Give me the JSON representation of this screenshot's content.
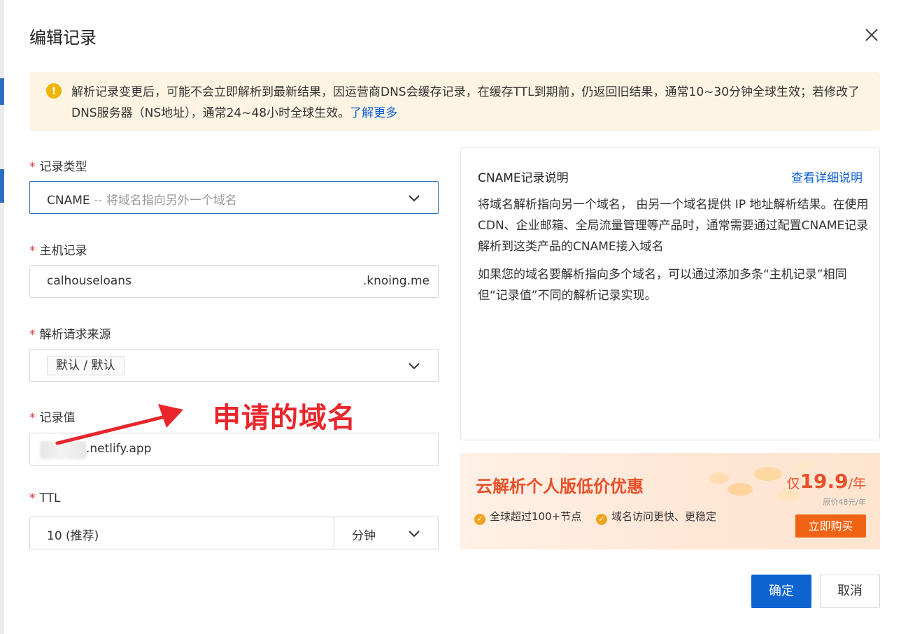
{
  "dialog": {
    "title": "编辑记录"
  },
  "notice": {
    "text": "解析记录变更后，可能不会立即解析到最新结果，因运营商DNS会缓存记录，在缓存TTL到期前，仍返回旧结果，通常10~30分钟全球生效；若修改了DNS服务器（NS地址），通常24~48小时全球生效。",
    "link": "了解更多"
  },
  "form": {
    "required_mark": "*",
    "record_type": {
      "label": "记录类型",
      "value": "CNAME",
      "hint": " -- 将域名指向另外一个域名"
    },
    "host": {
      "label": "主机记录",
      "value": "calhouseloans",
      "suffix": ".knoing.me"
    },
    "source": {
      "label": "解析请求来源",
      "value": "默认 / 默认"
    },
    "record_value": {
      "label": "记录值",
      "value": ".netlify.app"
    },
    "ttl": {
      "label": "TTL",
      "value": "10 (推荐)",
      "unit": "分钟"
    }
  },
  "annotation": {
    "text": "申请的域名",
    "color": "#e8262b"
  },
  "info": {
    "title": "CNAME记录说明",
    "detail_link": "查看详细说明",
    "paragraph1": "将域名解析指向另一个域名， 由另一个域名提供 IP 地址解析结果。在使用CDN、企业邮箱、全局流量管理等产品时，通常需要通过配置CNAME记录解析到这类产品的CNAME接入域名",
    "paragraph2": "如果您的域名要解析指向多个域名，可以通过添加多条“主机记录”相同但“记录值”不同的解析记录实现。"
  },
  "promo": {
    "title": "云解析个人版低价优惠",
    "price_prefix": "仅",
    "price": "19.9",
    "price_unit": "/年",
    "original_price": "原价48元/年",
    "features": [
      "全球超过100+节点",
      "域名访问更快、更稳定"
    ],
    "buy_label": "立即购买"
  },
  "buttons": {
    "confirm": "确定",
    "cancel": "取消"
  },
  "colors": {
    "primary": "#0b64d0",
    "link": "#0b5fd6",
    "required": "#e02c2c",
    "promo_accent": "#e8502a",
    "warning": "#f0b400"
  }
}
